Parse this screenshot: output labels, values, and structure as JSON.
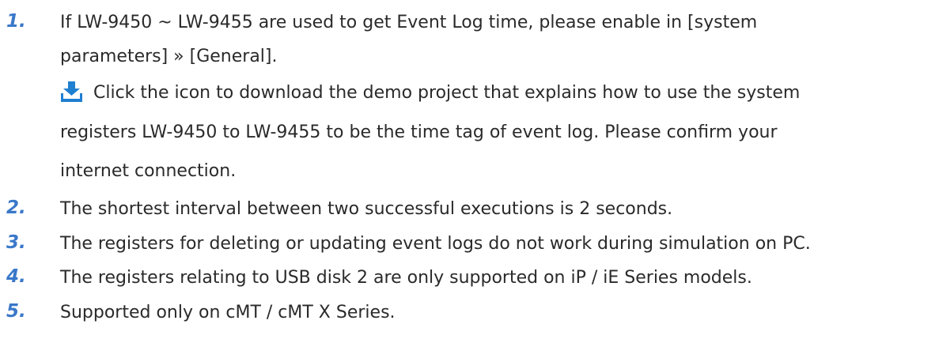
{
  "notes": [
    {
      "number": "1.",
      "lines": [
        "If LW-9450 ~ LW-9455 are used to get Event Log time, please enable in [system",
        "parameters] » [General]."
      ],
      "download": {
        "icon": "download-icon",
        "lines": [
          "Click the icon to download the demo project that explains how to use the system",
          "registers LW-9450 to LW-9455 to be the time tag of event log. Please confirm your",
          "internet connection."
        ]
      }
    },
    {
      "number": "2.",
      "lines": [
        "The shortest interval between two successful executions is 2 seconds."
      ]
    },
    {
      "number": "3.",
      "lines": [
        "The registers for deleting or updating event logs do not work during simulation on PC."
      ]
    },
    {
      "number": "4.",
      "lines": [
        "The registers relating to USB disk 2 are only supported on iP / iE Series models."
      ]
    },
    {
      "number": "5.",
      "lines": [
        "Supported only on cMT / cMT X Series."
      ]
    }
  ],
  "colors": {
    "number": "#3a78c9",
    "icon": "#1f7fd1",
    "text": "#2a2a2a"
  }
}
